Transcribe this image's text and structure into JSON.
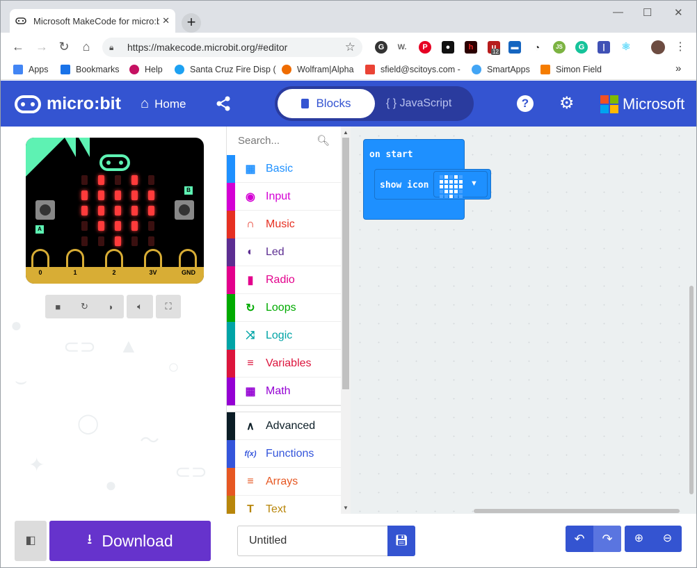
{
  "browser": {
    "tab_title": "Microsoft MakeCode for micro:bi",
    "tab_close": "✕",
    "new_tab": "+",
    "url": "https://makecode.microbit.org/#editor",
    "ext_badge": "12",
    "bookmarks": [
      {
        "label": "Apps",
        "color": "#4285f4"
      },
      {
        "label": "Bookmarks",
        "color": "#1a73e8"
      },
      {
        "label": "Help",
        "color": "#c51162"
      },
      {
        "label": "Santa Cruz Fire Disp (",
        "color": "#1da1f2"
      },
      {
        "label": "Wolfram|Alpha",
        "color": "#ef6c00"
      },
      {
        "label": "sfield@scitoys.com -",
        "color": "#ea4335"
      },
      {
        "label": "SmartApps",
        "color": "#42a5f5"
      },
      {
        "label": "Simon Field",
        "color": "#f57c00"
      }
    ],
    "more": "»"
  },
  "app": {
    "brand": "micro:bit",
    "home": "Home",
    "blocks": "Blocks",
    "javascript": "{ } JavaScript",
    "microsoft": "Microsoft",
    "help": "?"
  },
  "simulator": {
    "pins": [
      "0",
      "1",
      "2",
      "3V",
      "GND"
    ],
    "btn_a": "A",
    "btn_b": "B",
    "led_on": "#ff3b3b",
    "led_off": "#3a1010"
  },
  "toolbox": {
    "search_placeholder": "Search...",
    "categories": [
      {
        "label": "Basic",
        "color": "#1e90ff",
        "icon": "▦"
      },
      {
        "label": "Input",
        "color": "#d400d4",
        "icon": "◉"
      },
      {
        "label": "Music",
        "color": "#e63022",
        "icon": "∩"
      },
      {
        "label": "Led",
        "color": "#5c2d91",
        "icon": "◐"
      },
      {
        "label": "Radio",
        "color": "#e3008c",
        "icon": "▮"
      },
      {
        "label": "Loops",
        "color": "#00aa00",
        "icon": "↻"
      },
      {
        "label": "Logic",
        "color": "#00a4a6",
        "icon": "⤨"
      },
      {
        "label": "Variables",
        "color": "#dc143c",
        "icon": "≡"
      },
      {
        "label": "Math",
        "color": "#9400d3",
        "icon": "▦"
      }
    ],
    "advanced": [
      {
        "label": "Advanced",
        "color": "#0b1d26",
        "icon": "∧"
      },
      {
        "label": "Functions",
        "color": "#3455db",
        "icon": "f(x)"
      },
      {
        "label": "Arrays",
        "color": "#e65722",
        "icon": "≡"
      },
      {
        "label": "Text",
        "color": "#b8860b",
        "icon": "T"
      }
    ]
  },
  "workspace": {
    "on_start": "on start",
    "show_icon": "show icon",
    "dropdown": "▼"
  },
  "bottom": {
    "download": "Download",
    "project_name": "Untitled"
  }
}
